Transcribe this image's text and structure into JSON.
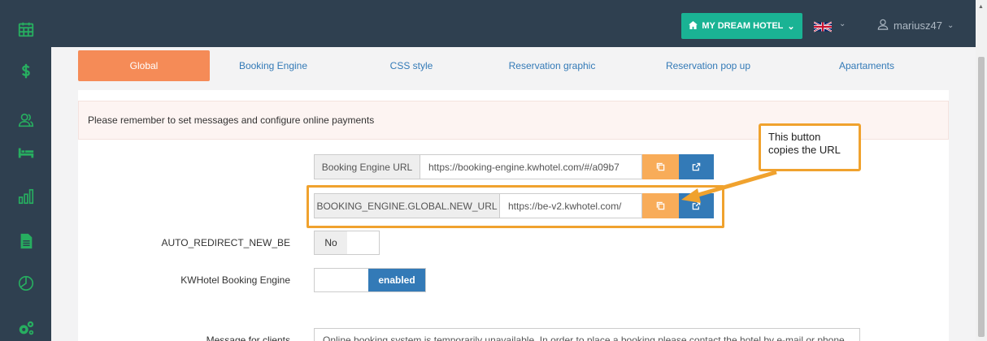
{
  "topbar": {
    "hotel_button": "MY DREAM HOTEL",
    "language_flag": "uk-flag-icon",
    "username": "mariusz47"
  },
  "sidebar": {
    "items": [
      {
        "icon": "calendar-icon"
      },
      {
        "icon": "dollar-icon"
      },
      {
        "icon": "users-icon"
      },
      {
        "icon": "bed-icon"
      },
      {
        "icon": "bar-chart-icon"
      },
      {
        "icon": "document-icon"
      },
      {
        "icon": "pie-chart-icon"
      },
      {
        "icon": "gears-icon"
      }
    ]
  },
  "tabs": [
    {
      "label": "Global",
      "active": true
    },
    {
      "label": "Booking Engine",
      "active": false
    },
    {
      "label": "CSS style",
      "active": false
    },
    {
      "label": "Reservation graphic",
      "active": false
    },
    {
      "label": "Reservation pop up",
      "active": false
    },
    {
      "label": "Apartaments",
      "active": false
    }
  ],
  "alert": {
    "text": "Please remember to set messages and configure online payments"
  },
  "fields": {
    "booking_engine_url": {
      "label": "Booking Engine URL",
      "value": "https://booking-engine.kwhotel.com/#/a09b7"
    },
    "new_url": {
      "label": "BOOKING_ENGINE.GLOBAL.NEW_URL",
      "value": "https://be-v2.kwhotel.com/"
    },
    "auto_redirect": {
      "label": "AUTO_REDIRECT_NEW_BE",
      "value": "No"
    },
    "kwhotel_booking_engine": {
      "label": "KWHotel Booking Engine",
      "value": "enabled"
    },
    "message_for_clients": {
      "label": "Message for clients",
      "value": "Online booking system is temporarily unavailable. In order to place a booking please contact the hotel by e-mail or phone"
    }
  },
  "callout": {
    "line1": "This button",
    "line2": "copies the URL"
  },
  "colors": {
    "sidebar": "#2f4050",
    "accent_green": "#1ab394",
    "tab_active": "#f58b57",
    "copy_button": "#f8ac59",
    "open_button": "#337ab7",
    "callout_border": "#f0a22e"
  }
}
